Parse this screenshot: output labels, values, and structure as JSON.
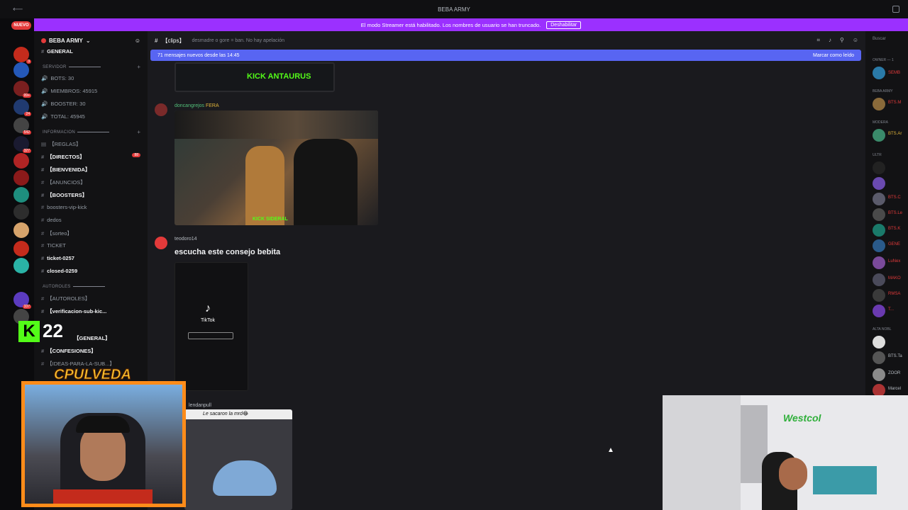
{
  "window": {
    "title": "BEBA ARMY"
  },
  "banner": {
    "text": "El modo Streamer está habilitado. Los nombres de usuario se han truncado.",
    "button": "Deshabilitar"
  },
  "rail": {
    "badge_new": "NUEVO",
    "badges": [
      "3",
      "99+",
      "24",
      "542",
      "327",
      "337",
      "167"
    ]
  },
  "server": {
    "name": "BEBA ARMY"
  },
  "sidebar": {
    "top_channel": "GENERAL",
    "categories": {
      "servidor": "SERVIDOR",
      "informacion": "INFORMACION",
      "autoroles": "AUTOROLES"
    },
    "servidor_items": [
      "BOTS: 30",
      "MIEMBROS: 45915",
      "BOOSTER: 30",
      "TOTAL: 45945"
    ],
    "info_items": [
      "【REGLAS】",
      "【DIRECTOS】",
      "【BIENVENIDA】",
      "【ANUNCIOS】",
      "【BOOSTERS】",
      "boosters-vip-kick",
      "dedos",
      "【sorteo】",
      "TICKET",
      "ticket-0257",
      "closed-0259"
    ],
    "autoroles_items": [
      "【AUTOROLES】",
      "【verificacion-sub-kic..."
    ],
    "more_items": [
      "【GENERAL】",
      "【CONFESIONES】",
      "【IDEAS-PARA-LA-SUB...】"
    ],
    "unread_directos": "88"
  },
  "chat": {
    "channel_name": "【clips】",
    "topic": "desmadre o gore = ban. No hay apelación",
    "new_messages": "71 mensajes nuevos desde las 14:45",
    "mark_read": "Marcar como leído",
    "messages": [
      {
        "author": "doncangrejos",
        "tag": "FERA",
        "caption": "KICK SIDERAL"
      },
      {
        "author": "teodoro14",
        "text": "escucha este consejo bebita",
        "embed": "TikTok"
      },
      {
        "author": "lendanpull",
        "caption": "Le sacaron la mrd😂"
      }
    ],
    "top_clip_caption": "KICK ANTAURUS"
  },
  "members": {
    "search": "Buscar",
    "roles": [
      "OWNER — 1",
      "BEBA ARMY",
      "MODERA",
      "ULTR",
      "ALTA NOBL"
    ],
    "names": [
      "SEMB",
      "BTS.M",
      "BTS.Ar",
      "BTS.C",
      "BTS.Le",
      "BTS.K",
      "GENE",
      "LuNex",
      "MAKO",
      "RMSA",
      "T...",
      "BTS.Ta",
      "ZOOR",
      "Marcel"
    ]
  },
  "overlay": {
    "kick_count": "22",
    "streamer_left": "CPULVEDA",
    "streamer_right_logo": "Westcol"
  },
  "colors": {
    "banner": "#9b30ff",
    "new_messages_bar": "#5865f2",
    "kick_green": "#53fc18",
    "cam_border": "#ff8c1a"
  }
}
